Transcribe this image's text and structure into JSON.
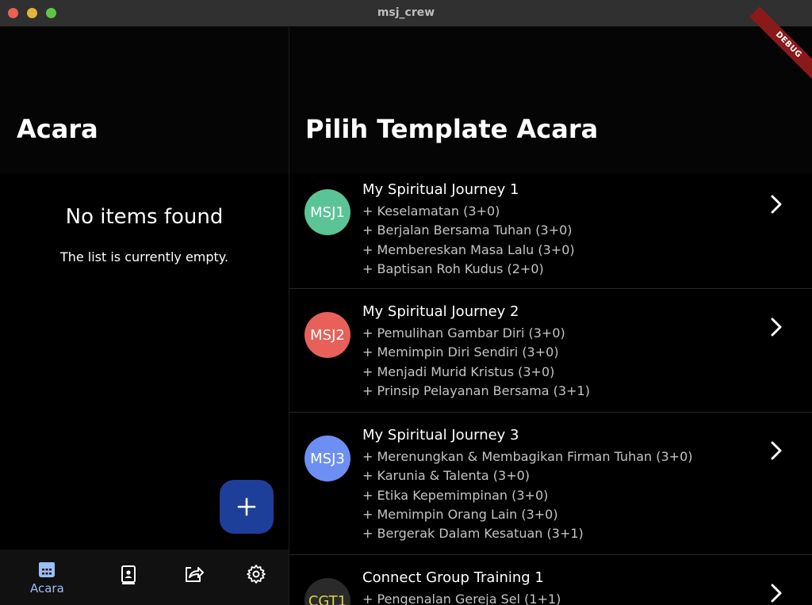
{
  "window": {
    "title": "msj_crew"
  },
  "left": {
    "title": "Acara",
    "empty_title": "No items found",
    "empty_subtitle": "The list is currently empty."
  },
  "fab": {
    "icon": "plus-icon"
  },
  "nav": {
    "items": [
      {
        "label": "Acara",
        "icon": "calendar-icon",
        "active": true
      },
      {
        "label": "",
        "icon": "contact-book-icon"
      },
      {
        "label": "",
        "icon": "share-icon"
      },
      {
        "label": "",
        "icon": "gear-icon"
      }
    ]
  },
  "right": {
    "title": "Pilih Template Acara",
    "debug_banner": "DEBUG",
    "templates": [
      {
        "avatar": "MSJ1",
        "color": "#5bc497",
        "title": "My Spiritual Journey 1",
        "lines": [
          "+ Keselamatan (3+0)",
          "+ Berjalan Bersama Tuhan (3+0)",
          "+ Membereskan Masa Lalu (3+0)",
          "+ Baptisan Roh Kudus (2+0)"
        ]
      },
      {
        "avatar": "MSJ2",
        "color": "#e8605a",
        "title": "My Spiritual Journey 2",
        "lines": [
          "+ Pemulihan Gambar Diri (3+0)",
          "+ Memimpin Diri Sendiri (3+0)",
          "+ Menjadi Murid Kristus (3+0)",
          "+ Prinsip Pelayanan Bersama (3+1)"
        ]
      },
      {
        "avatar": "MSJ3",
        "color": "#6d8ff3",
        "title": "My Spiritual Journey 3",
        "lines": [
          "+ Merenungkan & Membagikan Firman Tuhan (3+0)",
          "+ Karunia & Talenta (3+0)",
          "+ Etika Kepemimpinan (3+0)",
          "+ Memimpin Orang Lain (3+0)",
          "+ Bergerak Dalam Kesatuan (3+1)"
        ]
      },
      {
        "avatar": "CGT1",
        "color": "#2a2a2a",
        "text_color": "#d8d34a",
        "title": "Connect Group Training 1",
        "lines": [
          "+ Pengenalan Gereja Sel (1+1)"
        ]
      }
    ]
  }
}
